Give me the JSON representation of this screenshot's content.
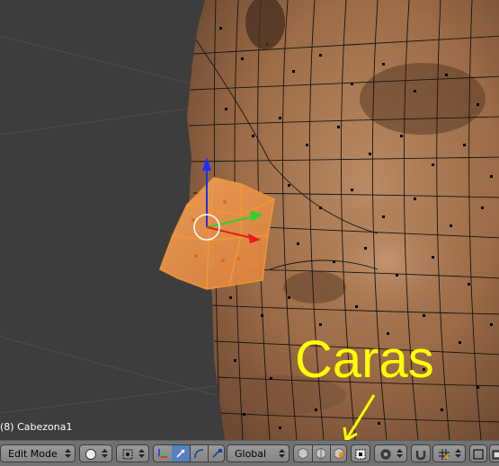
{
  "viewport": {
    "object_label": "(8) Cabezona1",
    "annotation": "Caras",
    "annotation_color": "#ffff00",
    "selection_color": "#f59a2f"
  },
  "toolbar": {
    "mode": "Edit Mode",
    "orientation": "Global",
    "icons": {
      "viewport_shade": "sphere-icon",
      "pivot": "pivot-icon",
      "manipulator": "manipulator-axis-icon",
      "translate": "translate-arrow-icon",
      "rotate": "rotate-arc-icon",
      "scale": "scale-icon",
      "vertex_select": "vertex-select-icon",
      "edge_select": "edge-select-icon",
      "face_select": "face-select-icon",
      "occlude": "occlude-geometry-icon",
      "proportional": "proportional-edit-icon",
      "snap": "magnet-icon",
      "snap_element": "snap-element-icon",
      "render": "render-icon"
    }
  }
}
